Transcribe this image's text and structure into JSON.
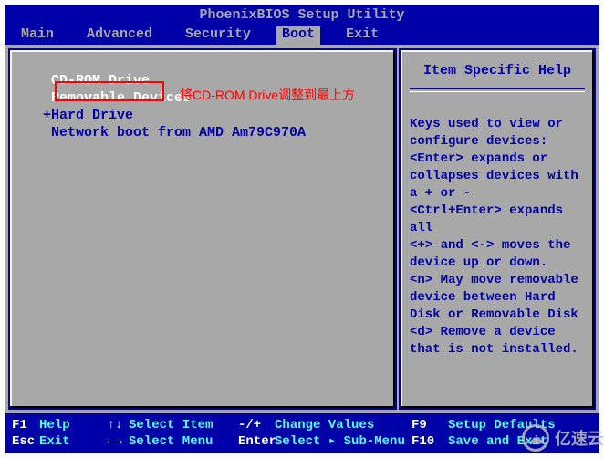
{
  "title": "PhoenixBIOS Setup Utility",
  "menu": {
    "items": [
      "Main",
      "Advanced",
      "Security",
      "Boot",
      "Exit"
    ],
    "active": "Boot"
  },
  "boot": {
    "items": [
      {
        "label": "CD-ROM Drive",
        "prefix": " ",
        "highlighted": true
      },
      {
        "label": "Removable Devices",
        "prefix": " ",
        "highlighted": true
      },
      {
        "label": "Hard Drive",
        "prefix": "+",
        "highlighted": false
      },
      {
        "label": "Network boot from AMD Am79C970A",
        "prefix": " ",
        "highlighted": false
      }
    ]
  },
  "annotation": "将CD-ROM Drive调整到最上方",
  "help": {
    "title": "Item Specific Help",
    "body": "Keys used to view or configure devices:\n<Enter> expands or collapses devices with a + or -\n<Ctrl+Enter> expands all\n<+> and <-> moves the device up or down.\n<n> May move removable device between Hard Disk or Removable Disk\n<d> Remove a device that is not installed."
  },
  "footer": {
    "row1": {
      "k1": "F1",
      "l1": "Help",
      "a1": "↑↓",
      "l2": "Select Item",
      "a2": "-/+",
      "l3": "Change Values",
      "k2": "F9",
      "l4": "Setup Defaults"
    },
    "row2": {
      "k1": "Esc",
      "l1": "Exit",
      "a1": "←→",
      "l2": "Select Menu",
      "a2": "Enter",
      "l3": "Select ▸ Sub-Menu",
      "k2": "F10",
      "l4": "Save and Exit"
    }
  },
  "watermark": "亿速云"
}
